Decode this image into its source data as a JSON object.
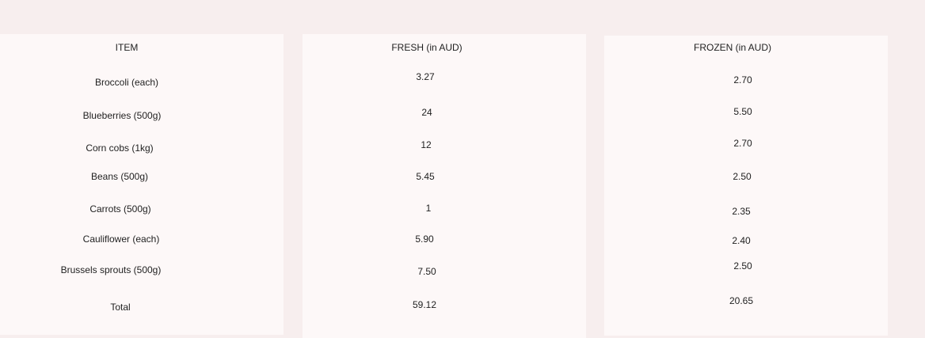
{
  "table": {
    "headers": {
      "item": "ITEM",
      "fresh": "FRESH (in AUD)",
      "frozen": "FROZEN (in AUD)"
    },
    "rows": [
      {
        "item": "Broccoli (each)",
        "fresh": "3.27",
        "frozen": "2.70"
      },
      {
        "item": "Blueberries (500g)",
        "fresh": "24",
        "frozen": "5.50"
      },
      {
        "item": "Corn cobs (1kg)",
        "fresh": "12",
        "frozen": "2.70"
      },
      {
        "item": "Beans (500g)",
        "fresh": "5.45",
        "frozen": "2.50"
      },
      {
        "item": "Carrots (500g)",
        "fresh": "1",
        "frozen": "2.35"
      },
      {
        "item": "Cauliflower (each)",
        "fresh": "5.90",
        "frozen": "2.40"
      },
      {
        "item": "Brussels sprouts (500g)",
        "fresh": "7.50",
        "frozen": "2.50"
      }
    ],
    "total": {
      "item": "Total",
      "fresh": "59.12",
      "frozen": "20.65"
    }
  }
}
